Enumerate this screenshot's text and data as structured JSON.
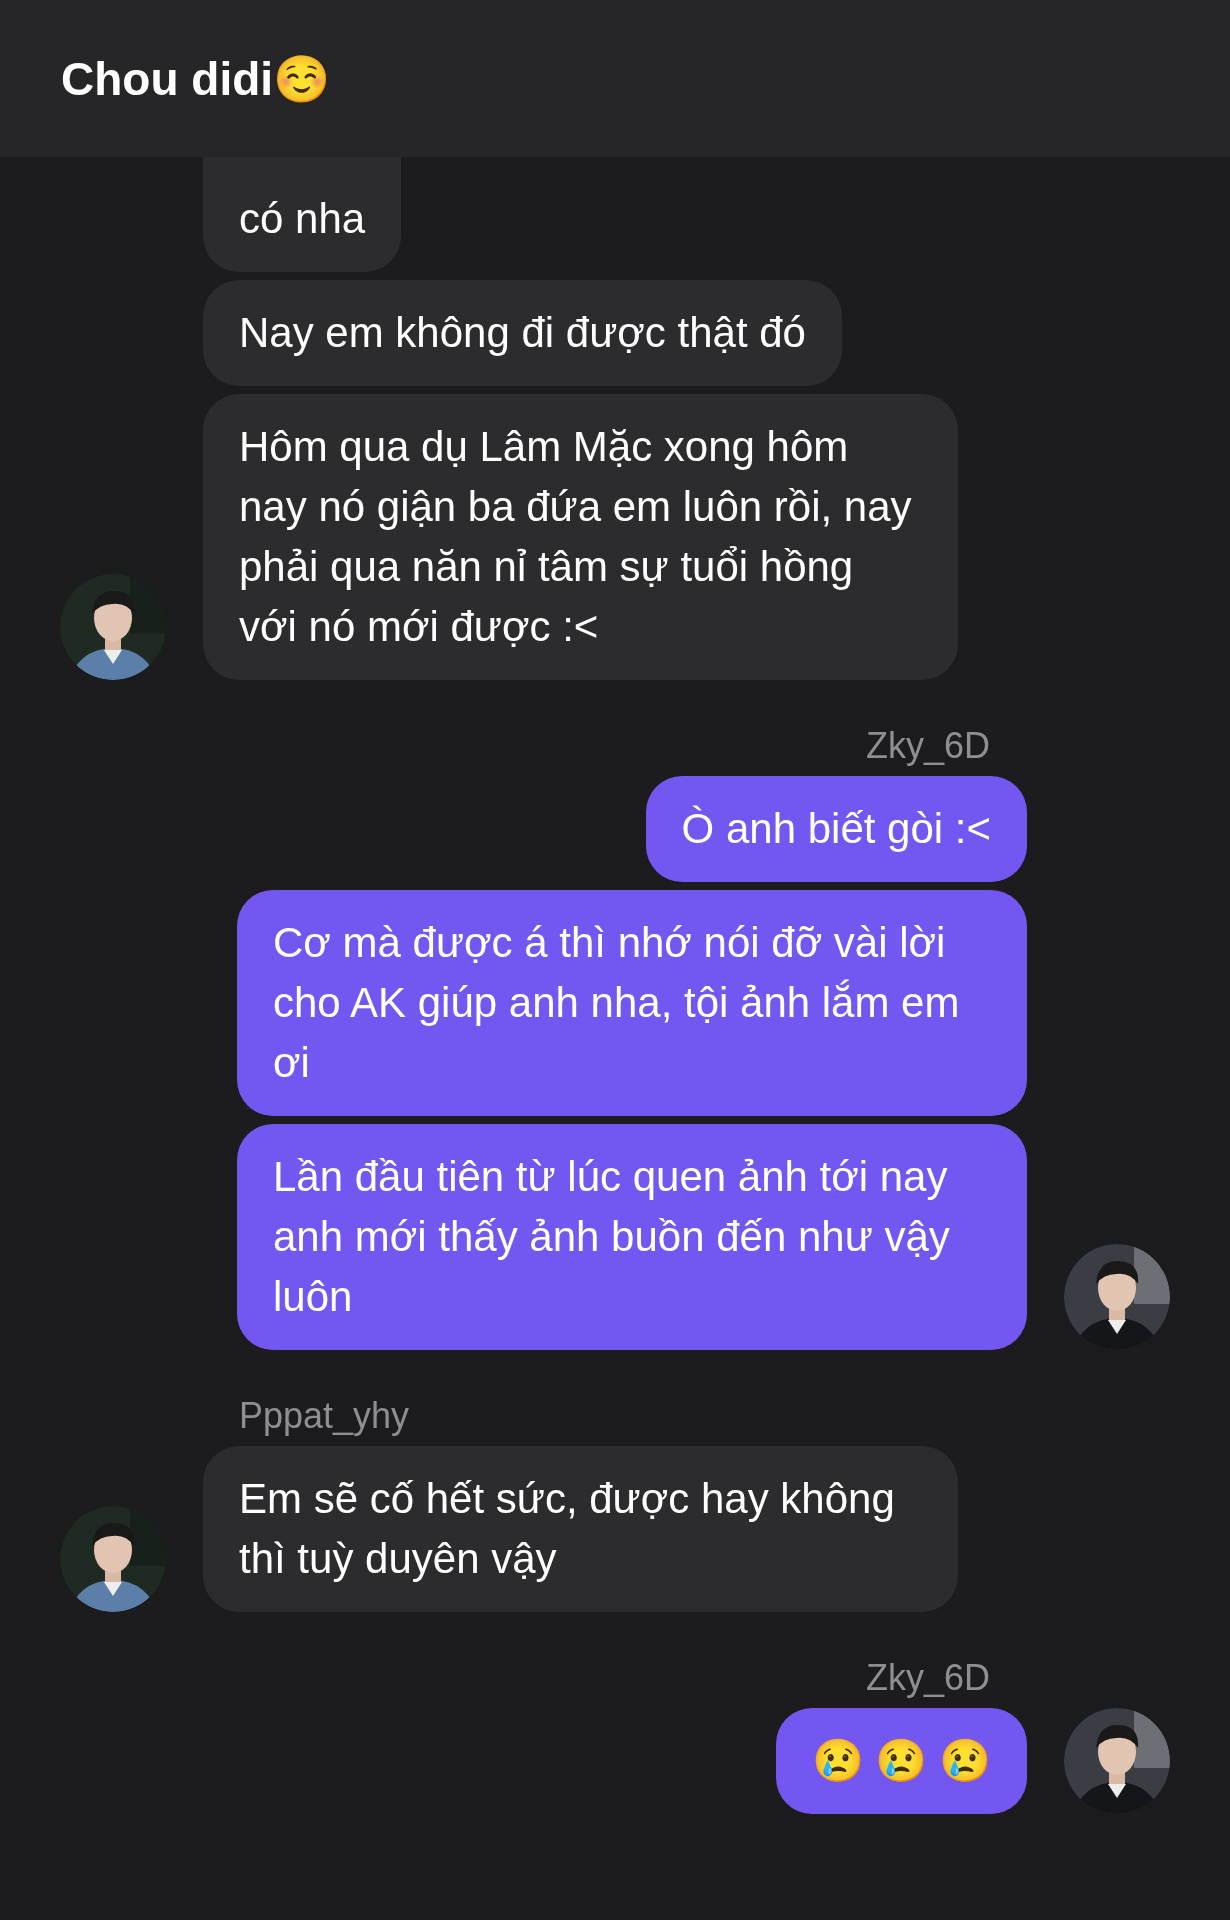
{
  "header": {
    "title": "Chou didi☺️"
  },
  "messages": [
    {
      "kind": "bubble",
      "sent": false,
      "text": "có nha",
      "avatar": false,
      "clipped": true
    },
    {
      "kind": "bubble",
      "sent": false,
      "text": "Nay em không đi được thật đó",
      "avatar": false,
      "clipped": false
    },
    {
      "kind": "bubble",
      "sent": false,
      "text": "Hôm qua dụ Lâm Mặc xong hôm nay nó giận ba đứa em luôn rồi, nay phải qua năn nỉ tâm sự tuổi hồng với nó mới được :<",
      "avatar": true,
      "clipped": false
    },
    {
      "kind": "sender",
      "text": "Zky_6D"
    },
    {
      "kind": "bubble",
      "sent": true,
      "text": "Ò anh biết gòi :<",
      "avatar": false,
      "clipped": false
    },
    {
      "kind": "bubble",
      "sent": true,
      "text": "Cơ mà được á thì nhớ nói đỡ vài lời cho AK giúp anh nha, tội ảnh lắm em ơi",
      "avatar": false,
      "clipped": false
    },
    {
      "kind": "bubble",
      "sent": true,
      "text": "Lần đầu tiên từ lúc quen ảnh tới nay anh mới thấy ảnh buồn đến như vậy luôn",
      "avatar": true,
      "clipped": false
    },
    {
      "kind": "sender",
      "text": "Pppat_yhy"
    },
    {
      "kind": "bubble",
      "sent": false,
      "text": "Em sẽ cố hết sức, được hay không thì tuỳ duyên vậy",
      "avatar": true,
      "clipped": false
    },
    {
      "kind": "sender",
      "text": "Zky_6D"
    },
    {
      "kind": "bubble",
      "sent": true,
      "text": "😢 😢 😢",
      "avatar": true,
      "clipped": false
    }
  ]
}
